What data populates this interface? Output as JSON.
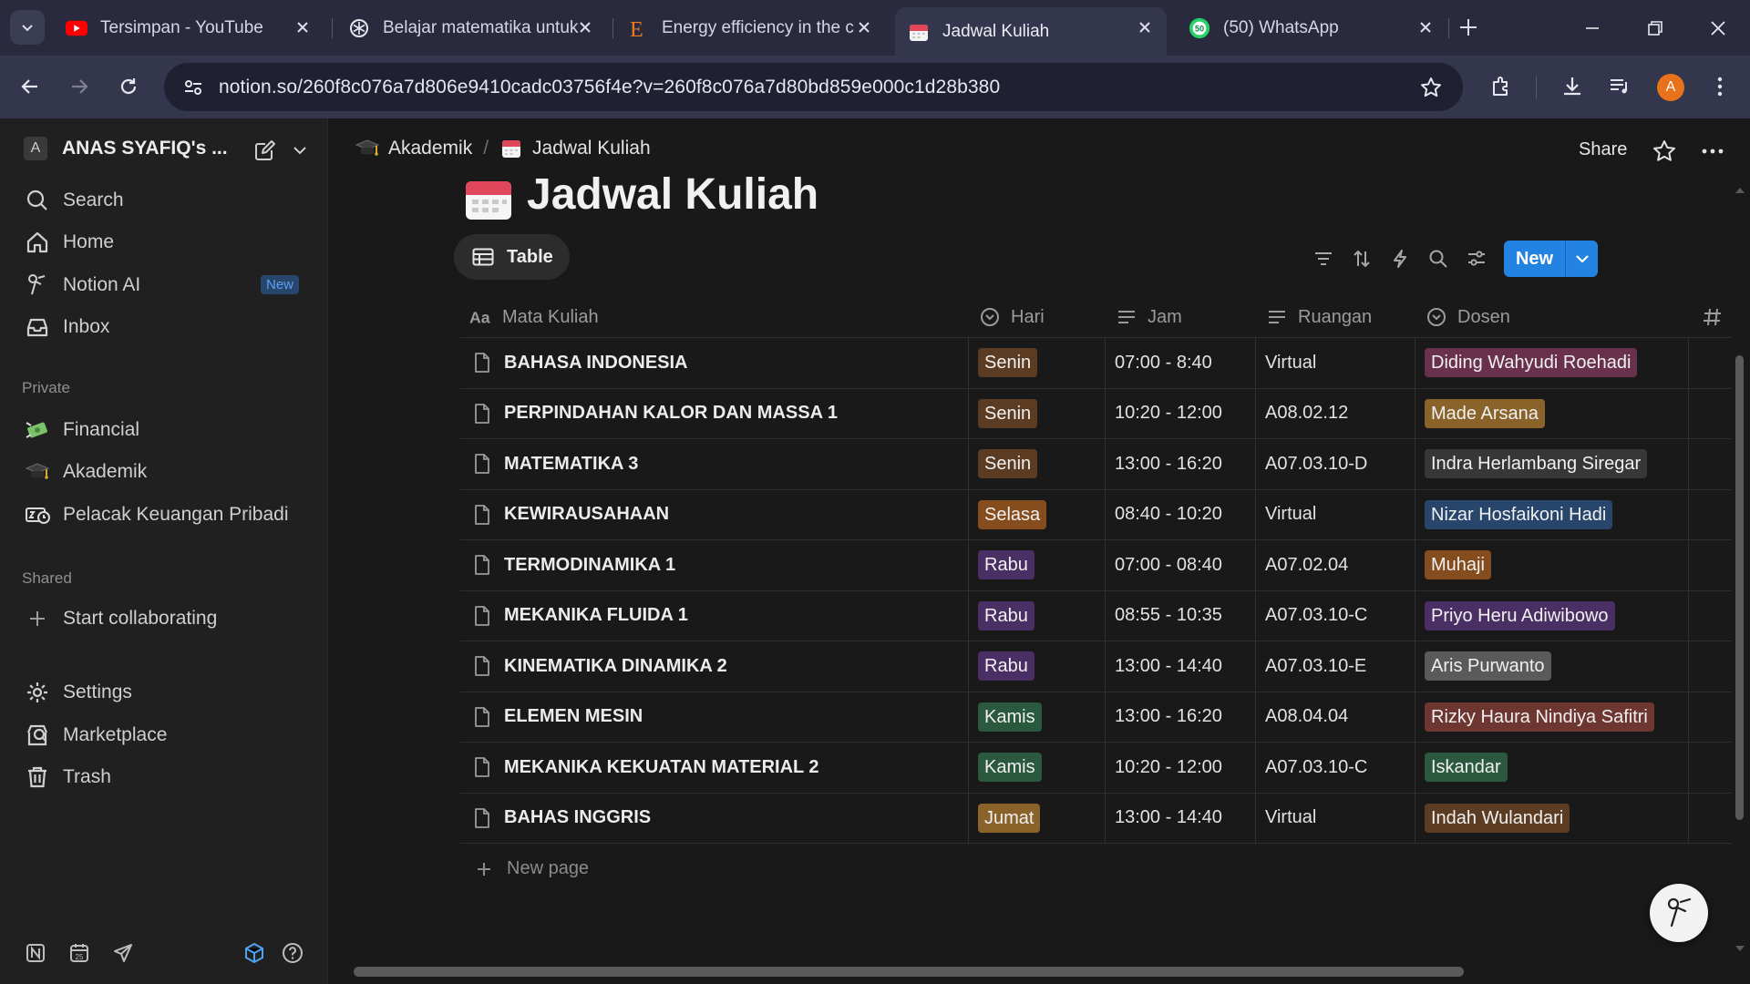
{
  "browser": {
    "tabs": [
      {
        "title": "Tersimpan - YouTube",
        "icon": "youtube-icon"
      },
      {
        "title": "Belajar matematika untuk",
        "icon": "chatgpt-icon"
      },
      {
        "title": "Energy efficiency in the c",
        "icon": "e-site-icon"
      },
      {
        "title": "Jadwal Kuliah",
        "icon": "calendar-icon"
      },
      {
        "title": "(50) WhatsApp",
        "icon": "whatsapp-icon"
      }
    ],
    "url": "notion.so/260f8c076a7d806e9410cadc03756f4e?v=260f8c076a7d80bd859e000c1d28b380",
    "profile_initial": "A",
    "whatsapp_count": "50"
  },
  "sidebar": {
    "workspace_initial": "A",
    "workspace_name": "ANAS SYAFIQ's ...",
    "top_items": [
      {
        "label": "Search"
      },
      {
        "label": "Home"
      },
      {
        "label": "Notion AI",
        "badge": "New"
      },
      {
        "label": "Inbox"
      }
    ],
    "private_heading": "Private",
    "private_items": [
      {
        "label": "Financial"
      },
      {
        "label": "Akademik"
      },
      {
        "label": "Pelacak Keuangan Pribadi"
      }
    ],
    "shared_heading": "Shared",
    "shared_items": [
      {
        "label": "Start collaborating"
      }
    ],
    "bottom_items": [
      {
        "label": "Settings"
      },
      {
        "label": "Marketplace"
      },
      {
        "label": "Trash"
      }
    ]
  },
  "page": {
    "breadcrumb": [
      "Akademik",
      "Jadwal Kuliah"
    ],
    "share_label": "Share",
    "title": "Jadwal Kuliah",
    "view_tab": "Table",
    "new_button": "New",
    "new_page_label": "New page",
    "columns": [
      "Mata Kuliah",
      "Hari",
      "Jam",
      "Ruangan",
      "Dosen"
    ],
    "rows": [
      {
        "mata_kuliah": "BAHASA INDONESIA",
        "hari": "Senin",
        "jam": "07:00 - 8:40",
        "ruangan": "Virtual",
        "dosen": "Diding Wahyudi Roehadi"
      },
      {
        "mata_kuliah": "PERPINDAHAN KALOR DAN MASSA 1",
        "hari": "Senin",
        "jam": "10:20 - 12:00",
        "ruangan": "A08.02.12",
        "dosen": "Made Arsana"
      },
      {
        "mata_kuliah": "MATEMATIKA 3",
        "hari": "Senin",
        "jam": "13:00 - 16:20",
        "ruangan": "A07.03.10-D",
        "dosen": "Indra Herlambang Siregar"
      },
      {
        "mata_kuliah": "KEWIRAUSAHAAN",
        "hari": "Selasa",
        "jam": "08:40 - 10:20",
        "ruangan": "Virtual",
        "dosen": "Nizar Hosfaikoni Hadi"
      },
      {
        "mata_kuliah": "TERMODINAMIKA 1",
        "hari": "Rabu",
        "jam": "07:00 - 08:40",
        "ruangan": "A07.02.04",
        "dosen": "Muhaji"
      },
      {
        "mata_kuliah": "MEKANIKA FLUIDA 1",
        "hari": "Rabu",
        "jam": "08:55 - 10:35",
        "ruangan": "A07.03.10-C",
        "dosen": "Priyo Heru Adiwibowo"
      },
      {
        "mata_kuliah": "KINEMATIKA DINAMIKA 2",
        "hari": "Rabu",
        "jam": "13:00 - 14:40",
        "ruangan": "A07.03.10-E",
        "dosen": "Aris Purwanto"
      },
      {
        "mata_kuliah": "ELEMEN MESIN",
        "hari": "Kamis",
        "jam": "13:00 - 16:20",
        "ruangan": "A08.04.04",
        "dosen": "Rizky Haura Nindiya Safitri"
      },
      {
        "mata_kuliah": "MEKANIKA KEKUATAN MATERIAL 2",
        "hari": "Kamis",
        "jam": "10:20 - 12:00",
        "ruangan": "A07.03.10-C",
        "dosen": "Iskandar"
      },
      {
        "mata_kuliah": "BAHAS INGGRIS",
        "hari": "Jumat",
        "jam": "13:00 - 14:40",
        "ruangan": "Virtual",
        "dosen": "Indah Wulandari"
      }
    ]
  },
  "colors": {
    "hari": {
      "Senin": "#5c3b23",
      "Selasa": "#854c1d",
      "Rabu": "#492f64",
      "Kamis": "#2b593f",
      "Jumat": "#89632a"
    },
    "dosen": [
      "#69314c",
      "#89632a",
      "#373737",
      "#28456c",
      "#854c1d",
      "#492f64",
      "#5a5a5a",
      "#6e3630",
      "#2b593f",
      "#5c3b23"
    ],
    "accent": "#2383e2"
  }
}
